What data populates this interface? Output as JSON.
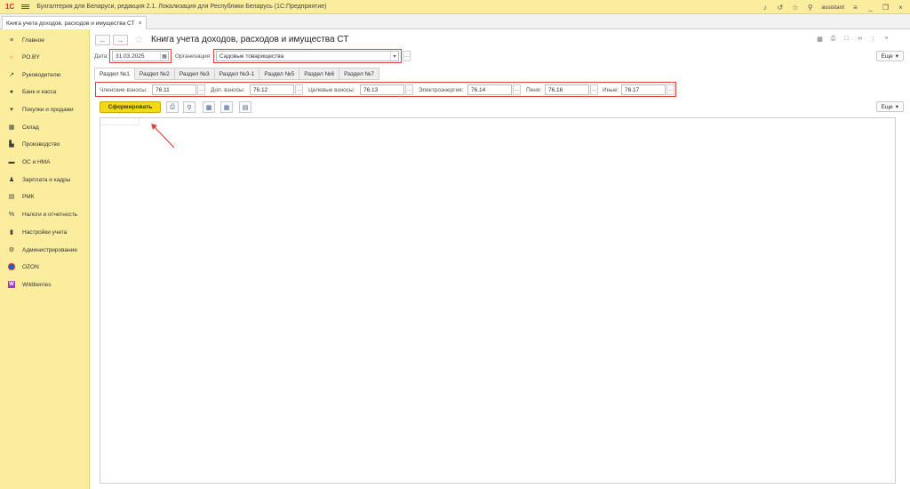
{
  "app": {
    "logo": "1С",
    "title": "Бухгалтерия для Беларуси, редакция 2.1. Локализация для Республики Беларусь   (1С:Предприятие)",
    "user": "assistant"
  },
  "doc_tab": {
    "label": "Книга учета доходов, расходов и имущества СТ",
    "close": "×"
  },
  "sidebar": {
    "items": [
      {
        "label": "Главное",
        "icon": "menu-icon",
        "glyph": "≡"
      },
      {
        "label": "РО.BY",
        "icon": "sun-icon",
        "glyph": "☼"
      },
      {
        "label": "Руководителю",
        "icon": "trend-icon",
        "glyph": "↗"
      },
      {
        "label": "Банк и касса",
        "icon": "bank-icon",
        "glyph": "●"
      },
      {
        "label": "Покупки и продажи",
        "icon": "cart-icon",
        "glyph": "▾"
      },
      {
        "label": "Склад",
        "icon": "warehouse-icon",
        "glyph": "▦"
      },
      {
        "label": "Производство",
        "icon": "factory-icon",
        "glyph": "▙"
      },
      {
        "label": "ОС и НМА",
        "icon": "truck-icon",
        "glyph": "▬"
      },
      {
        "label": "Зарплата и кадры",
        "icon": "person-icon",
        "glyph": "♟"
      },
      {
        "label": "РМК",
        "icon": "register-icon",
        "glyph": "▤"
      },
      {
        "label": "Налоги и отчетность",
        "icon": "percent-icon",
        "glyph": "%"
      },
      {
        "label": "Настройки учета",
        "icon": "book-icon",
        "glyph": "▮"
      },
      {
        "label": "Администрирование",
        "icon": "gear-icon",
        "glyph": "⚙"
      },
      {
        "label": "OZON",
        "icon": "ozon-icon",
        "glyph": ""
      },
      {
        "label": "Wildberries",
        "icon": "wildberries-icon",
        "glyph": "W"
      }
    ]
  },
  "form": {
    "title": "Книга учета доходов, расходов и имущества СТ",
    "date_label": "Дата:",
    "date_value": "31.03.2025",
    "org_label": "Организация:",
    "org_value": "Садовые товарищества",
    "more_label": "Еще",
    "tabs": [
      "Раздел №1",
      "Раздел №2",
      "Раздел №3",
      "Раздел №3-1",
      "Раздел №5",
      "Раздел №6",
      "Раздел №7"
    ],
    "accounts": [
      {
        "label": "Членские взносы:",
        "value": "76.11"
      },
      {
        "label": "Доп. взносы:",
        "value": "76.12"
      },
      {
        "label": "Целевые взносы:",
        "value": "76.13"
      },
      {
        "label": "Электроэнергия:",
        "value": "76.14"
      },
      {
        "label": "Пеня:",
        "value": "76.16"
      },
      {
        "label": "Иные:",
        "value": "76.17"
      }
    ],
    "generate_label": "Сформировать",
    "toolbar_more_label": "Еще"
  },
  "colors": {
    "sidebar_bg": "#fbed9e",
    "accent_button": "#f5d81a",
    "highlight_red": "#e0403a"
  }
}
